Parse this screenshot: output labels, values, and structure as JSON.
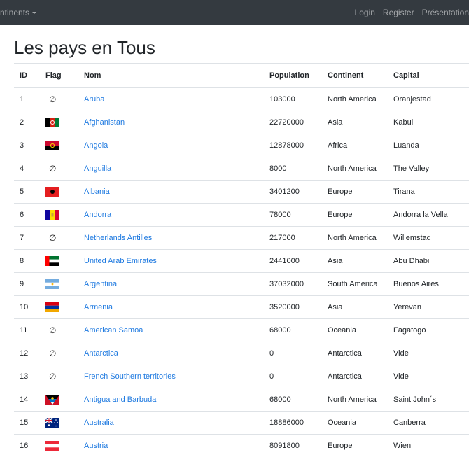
{
  "navbar": {
    "continents_label": "ntinents",
    "login_label": "Login",
    "register_label": "Register",
    "presentation_label": "Présentation"
  },
  "page": {
    "title": "Les pays en Tous"
  },
  "table": {
    "headers": {
      "id": "ID",
      "flag": "Flag",
      "name": "Nom",
      "population": "Population",
      "continent": "Continent",
      "capital": "Capital"
    },
    "rows": [
      {
        "id": "1",
        "flag": "none",
        "name": "Aruba",
        "population": "103000",
        "continent": "North America",
        "capital": "Oranjestad"
      },
      {
        "id": "2",
        "flag": "afghanistan",
        "name": "Afghanistan",
        "population": "22720000",
        "continent": "Asia",
        "capital": "Kabul"
      },
      {
        "id": "3",
        "flag": "angola",
        "name": "Angola",
        "population": "12878000",
        "continent": "Africa",
        "capital": "Luanda"
      },
      {
        "id": "4",
        "flag": "none",
        "name": "Anguilla",
        "population": "8000",
        "continent": "North America",
        "capital": "The Valley"
      },
      {
        "id": "5",
        "flag": "albania",
        "name": "Albania",
        "population": "3401200",
        "continent": "Europe",
        "capital": "Tirana"
      },
      {
        "id": "6",
        "flag": "andorra",
        "name": "Andorra",
        "population": "78000",
        "continent": "Europe",
        "capital": "Andorra la Vella"
      },
      {
        "id": "7",
        "flag": "none",
        "name": "Netherlands Antilles",
        "population": "217000",
        "continent": "North America",
        "capital": "Willemstad"
      },
      {
        "id": "8",
        "flag": "uae",
        "name": "United Arab Emirates",
        "population": "2441000",
        "continent": "Asia",
        "capital": "Abu Dhabi"
      },
      {
        "id": "9",
        "flag": "argentina",
        "name": "Argentina",
        "population": "37032000",
        "continent": "South America",
        "capital": "Buenos Aires"
      },
      {
        "id": "10",
        "flag": "armenia",
        "name": "Armenia",
        "population": "3520000",
        "continent": "Asia",
        "capital": "Yerevan"
      },
      {
        "id": "11",
        "flag": "none",
        "name": "American Samoa",
        "population": "68000",
        "continent": "Oceania",
        "capital": "Fagatogo"
      },
      {
        "id": "12",
        "flag": "none",
        "name": "Antarctica",
        "population": "0",
        "continent": "Antarctica",
        "capital": "Vide"
      },
      {
        "id": "13",
        "flag": "none",
        "name": "French Southern territories",
        "population": "0",
        "continent": "Antarctica",
        "capital": "Vide"
      },
      {
        "id": "14",
        "flag": "antigua",
        "name": "Antigua and Barbuda",
        "population": "68000",
        "continent": "North America",
        "capital": "Saint John´s"
      },
      {
        "id": "15",
        "flag": "australia",
        "name": "Australia",
        "population": "18886000",
        "continent": "Oceania",
        "capital": "Canberra"
      },
      {
        "id": "16",
        "flag": "austria",
        "name": "Austria",
        "population": "8091800",
        "continent": "Europe",
        "capital": "Wien"
      }
    ]
  },
  "no_flag_glyph": "∅",
  "colors": {
    "navbar_bg": "#343a40",
    "link": "#1f7ae0"
  }
}
